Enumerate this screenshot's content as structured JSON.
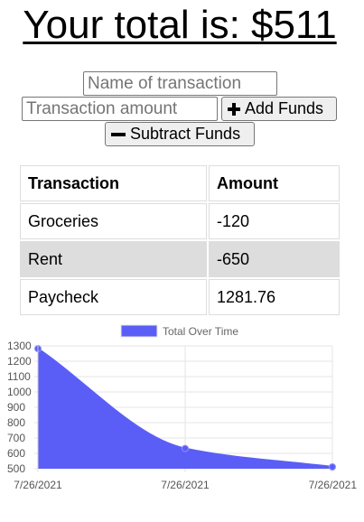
{
  "header": {
    "total_text": "Your total is: $511"
  },
  "form": {
    "name_placeholder": "Name of transaction",
    "amount_placeholder": "Transaction amount",
    "add_label": "Add Funds",
    "subtract_label": "Subtract Funds"
  },
  "table": {
    "headers": [
      "Transaction",
      "Amount"
    ],
    "rows": [
      {
        "name": "Groceries",
        "amount": "-120"
      },
      {
        "name": "Rent",
        "amount": "-650"
      },
      {
        "name": "Paycheck",
        "amount": "1281.76"
      }
    ]
  },
  "chart_data": {
    "type": "area",
    "legend": "Total Over Time",
    "legend_placement": "top",
    "x": [
      "7/26/2021",
      "7/26/2021",
      "7/26/2021"
    ],
    "series": [
      {
        "name": "Total Over Time",
        "values": [
          1281.76,
          631.76,
          511.76
        ]
      }
    ],
    "ylim": [
      500,
      1300
    ],
    "yticks": [
      500,
      600,
      700,
      800,
      900,
      1000,
      1100,
      1200,
      1300
    ],
    "grid": true,
    "fill_color": "#5b5ef6",
    "line_color": "#5b5ef6"
  }
}
